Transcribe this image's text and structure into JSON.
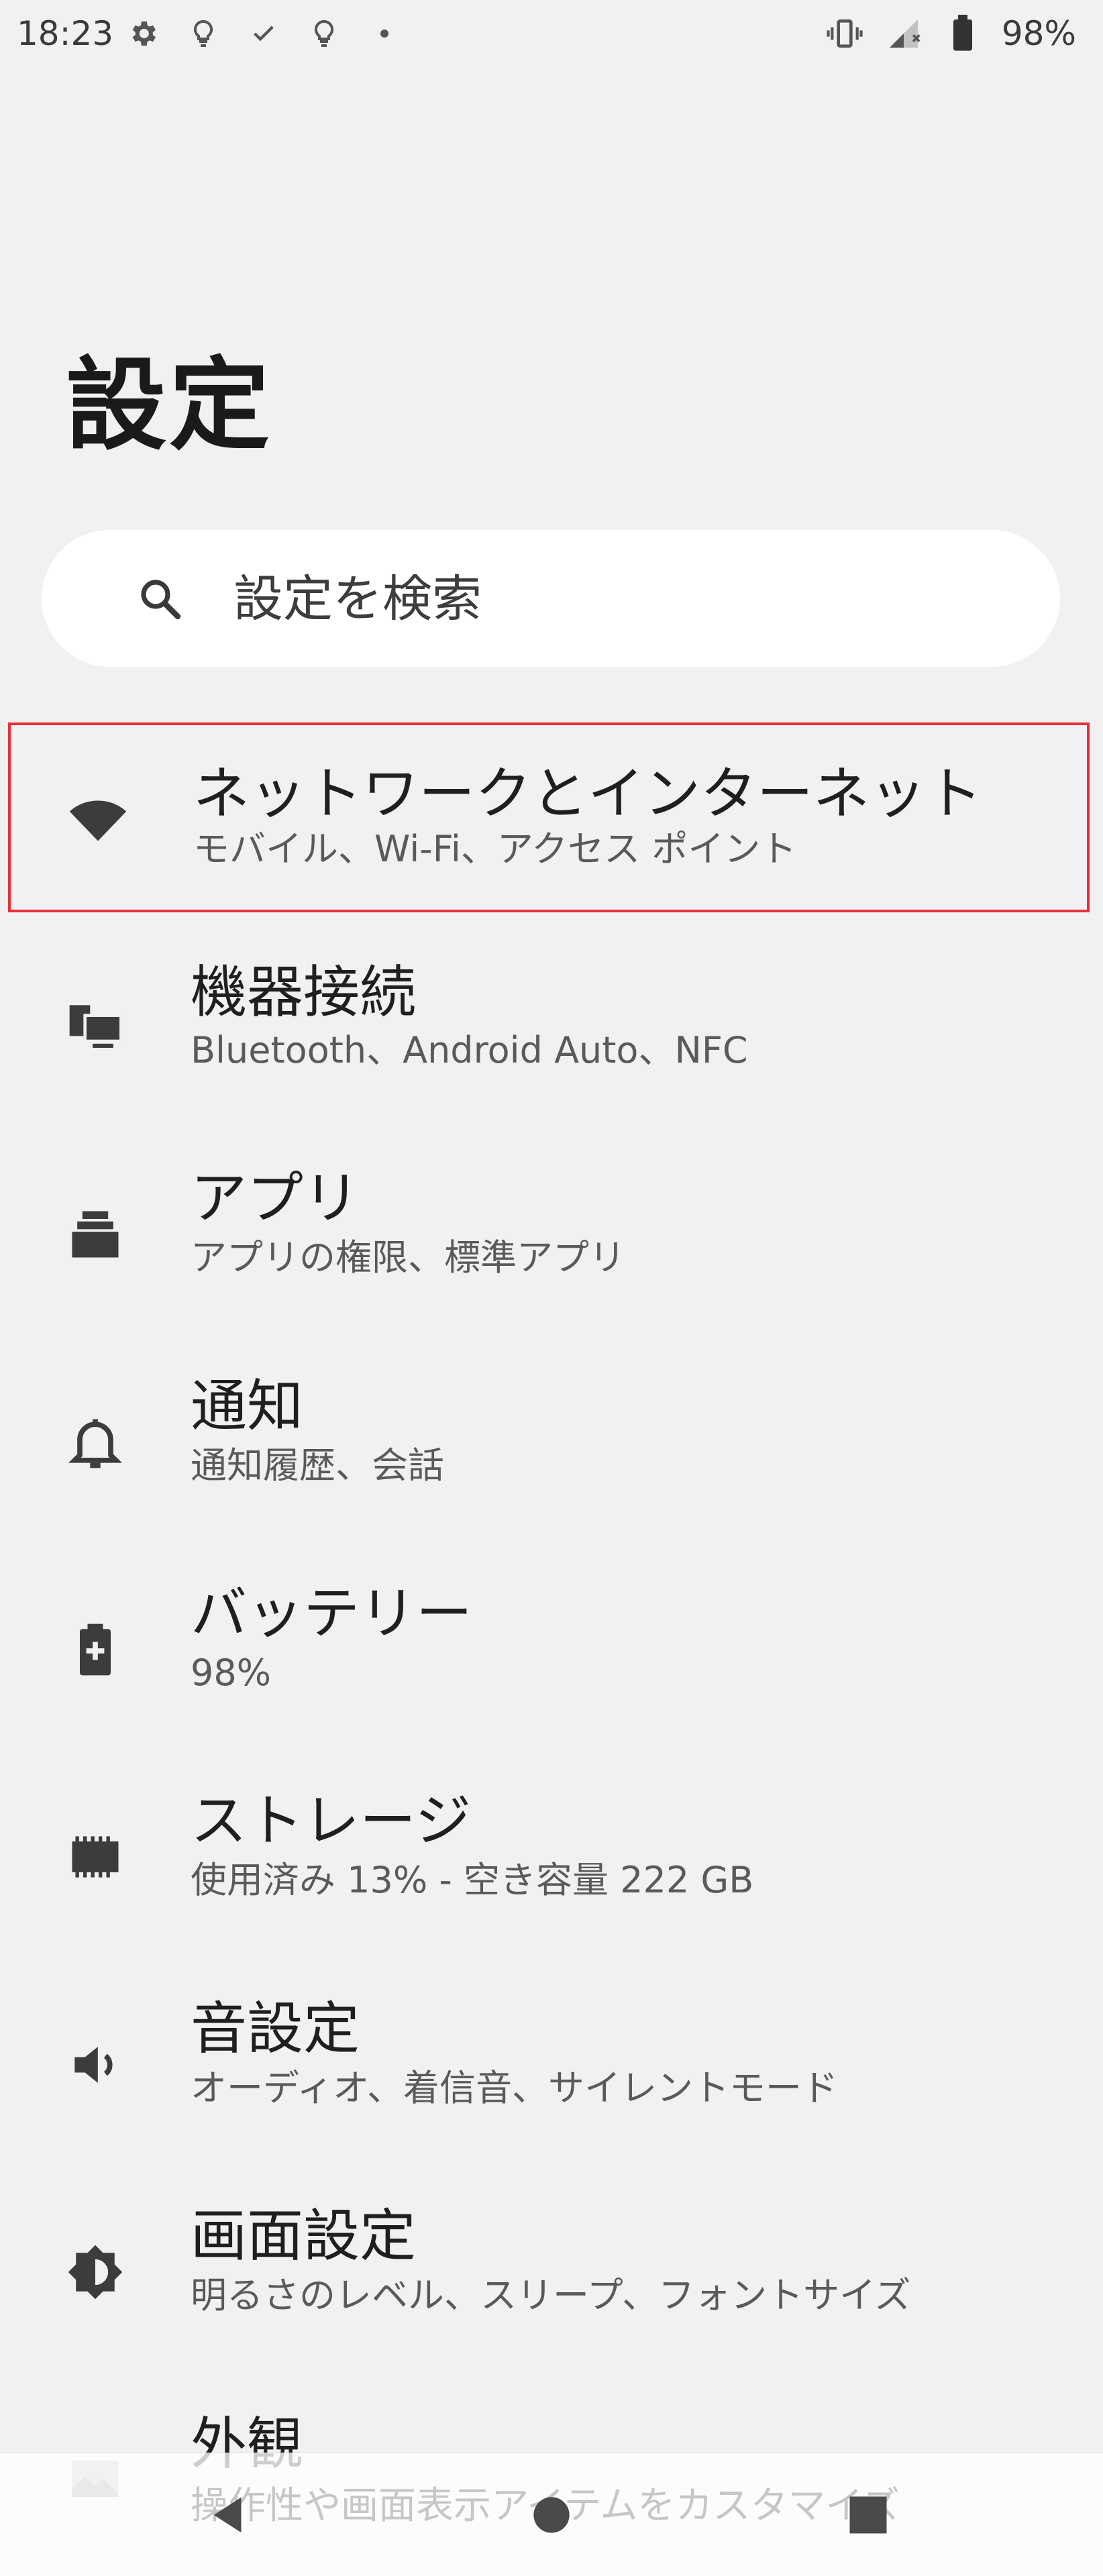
{
  "status_bar": {
    "time": "18:23",
    "battery_percent": "98%",
    "left_icons": [
      "gear-icon",
      "lightbulb-icon",
      "check-icon",
      "lightbulb-icon",
      "dot-icon"
    ],
    "right_icons": [
      "vibrate-icon",
      "signal-icon",
      "battery-icon"
    ]
  },
  "page": {
    "title": "設定"
  },
  "search": {
    "placeholder": "設定を検索",
    "icon": "search-icon"
  },
  "settings_items": [
    {
      "title": "ネットワークとインターネット",
      "subtitle": "モバイル、Wi-Fi、アクセス ポイント",
      "icon": "wifi-icon",
      "highlighted": true
    },
    {
      "title": "機器接続",
      "subtitle": "Bluetooth、Android Auto、NFC",
      "icon": "devices-icon"
    },
    {
      "title": "アプリ",
      "subtitle": "アプリの権限、標準アプリ",
      "icon": "apps-icon"
    },
    {
      "title": "通知",
      "subtitle": "通知履歴、会話",
      "icon": "bell-icon"
    },
    {
      "title": "バッテリー",
      "subtitle": "98%",
      "icon": "battery-icon"
    },
    {
      "title": "ストレージ",
      "subtitle": "使用済み 13% - 空き容量 222 GB",
      "icon": "storage-icon"
    },
    {
      "title": "音設定",
      "subtitle": "オーディオ、着信音、サイレントモード",
      "icon": "volume-icon"
    },
    {
      "title": "画面設定",
      "subtitle": "明るさのレベル、スリープ、フォントサイズ",
      "icon": "brightness-icon"
    },
    {
      "title": "外観",
      "subtitle": "操作性や画面表示アイテムをカスタマイズ",
      "icon": "wallpaper-icon"
    }
  ],
  "nav_bar": {
    "buttons": [
      "back-icon",
      "home-icon",
      "recents-icon"
    ]
  },
  "colors": {
    "background": "#f1f1f3",
    "highlight_border": "#e8303a",
    "icon": "#3c3c3c"
  }
}
